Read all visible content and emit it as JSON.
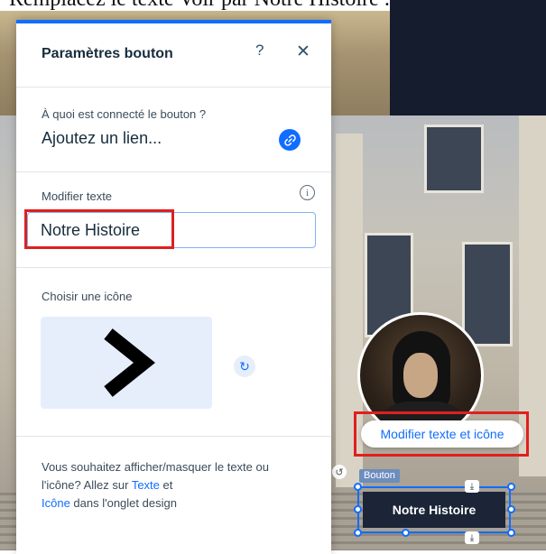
{
  "page_heading": "Remplacez le texte Voir par Notre Histoire :",
  "panel": {
    "title": "Paramètres bouton",
    "help_icon": "?",
    "close_icon": "✕",
    "link_section": {
      "question": "À quoi est connecté le bouton ?",
      "value": "Ajoutez un lien..."
    },
    "text_section": {
      "label": "Modifier texte",
      "input_value": "Notre Histoire"
    },
    "icon_section": {
      "label": "Choisir une icône",
      "selected_icon": "chevron-right-icon"
    },
    "footer": {
      "part1": "Vous souhaitez afficher/masquer le texte ou l'icône? Allez sur ",
      "link1": "Texte",
      "part2": " et ",
      "link2": "Icône",
      "part3": " dans l'onglet design"
    }
  },
  "canvas": {
    "action_label": "Modifier texte et icône",
    "element_tag": "Bouton",
    "button_text": "Notre Histoire"
  },
  "colors": {
    "accent": "#116dff",
    "highlight": "#e01f1f",
    "button_bg": "#1b2537"
  }
}
